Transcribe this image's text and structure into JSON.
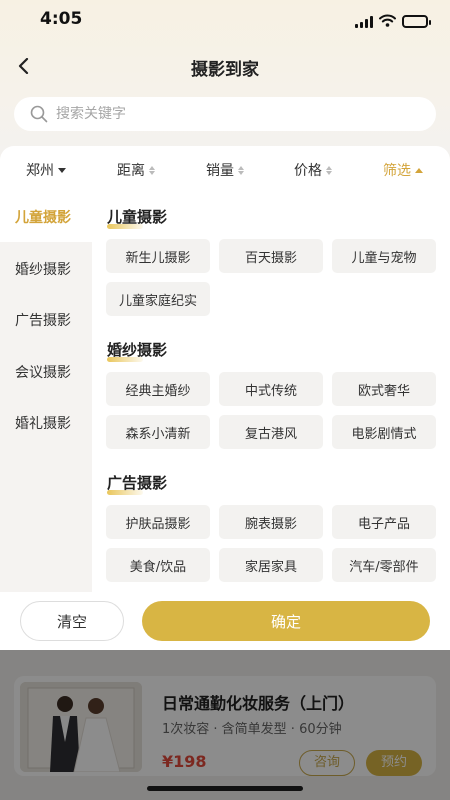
{
  "status": {
    "time": "4:05"
  },
  "nav": {
    "title": "摄影到家"
  },
  "search": {
    "placeholder": "搜索关键字"
  },
  "sort_bar": {
    "city": "郑州",
    "distance": "距离",
    "sales": "销量",
    "price": "价格",
    "filter": "筛选"
  },
  "sidebar": {
    "items": [
      {
        "label": "儿童摄影"
      },
      {
        "label": "婚纱摄影"
      },
      {
        "label": "广告摄影"
      },
      {
        "label": "会议摄影"
      },
      {
        "label": "婚礼摄影"
      }
    ]
  },
  "sections": [
    {
      "title": "儿童摄影",
      "options": [
        "新生儿摄影",
        "百天摄影",
        "儿童与宠物",
        "儿童家庭纪实"
      ]
    },
    {
      "title": "婚纱摄影",
      "options": [
        "经典主婚纱",
        "中式传统",
        "欧式奢华",
        "森系小清新",
        "复古港风",
        "电影剧情式"
      ]
    },
    {
      "title": "广告摄影",
      "options": [
        "护肤品摄影",
        "腕表摄影",
        "电子产品",
        "美食/饮品",
        "家居家具",
        "汽车/零部件"
      ]
    }
  ],
  "footer": {
    "clear_label": "清空",
    "confirm_label": "确定"
  },
  "background_card": {
    "title": "日常通勤化妆服务（上门）",
    "subtitle": "1次妆容 · 含简单发型 · 60分钟",
    "price": "¥198",
    "consult_label": "咨询",
    "book_label": "预约"
  },
  "colors": {
    "accent": "#d8b544",
    "active_text": "#d3a43a",
    "price": "#e24a3b"
  },
  "icons": [
    "back-arrow-icon",
    "search-icon",
    "signal-icon",
    "wifi-icon",
    "battery-icon",
    "caret-down-icon",
    "caret-up-icon",
    "sort-arrows-icon"
  ]
}
